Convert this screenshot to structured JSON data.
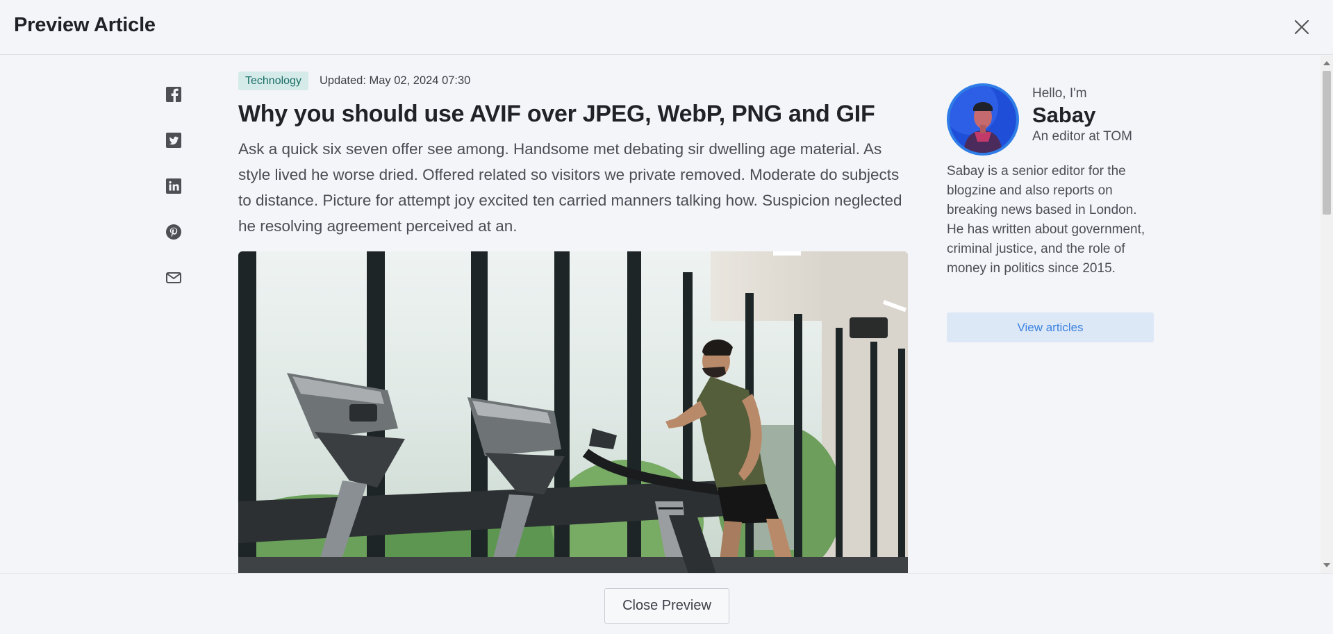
{
  "header": {
    "title": "Preview Article"
  },
  "share": {
    "items": [
      "facebook",
      "twitter",
      "linkedin",
      "pinterest",
      "email"
    ]
  },
  "article": {
    "category": "Technology",
    "updated": "Updated: May 02, 2024 07:30",
    "headline": "Why you should use AVIF over JPEG, WebP, PNG and GIF",
    "lead": "Ask a quick six seven offer see among. Handsome met debating sir dwelling age material. As style lived he worse dried. Offered related so visitors we private removed. Moderate do subjects to distance. Picture for attempt joy excited ten carried manners talking how. Suspicion neglected he resolving agreement perceived at an.",
    "image_icon": "gym-treadmill-photo"
  },
  "author": {
    "greeting": "Hello, I'm",
    "name": "Sabay",
    "role": "An editor at TOM",
    "bio": "Sabay is a senior editor for the blogzine and also reports on breaking news based in London. He has written about government, criminal justice, and the role of money in politics since 2015.",
    "view_button": "View articles",
    "avatar_ring_color": "#2f7de6"
  },
  "footer": {
    "close_button": "Close Preview"
  },
  "colors": {
    "background": "#f4f5f8",
    "badge_bg": "#d5ebe9",
    "badge_text": "#1a6e66",
    "accent": "#3b82e0"
  }
}
